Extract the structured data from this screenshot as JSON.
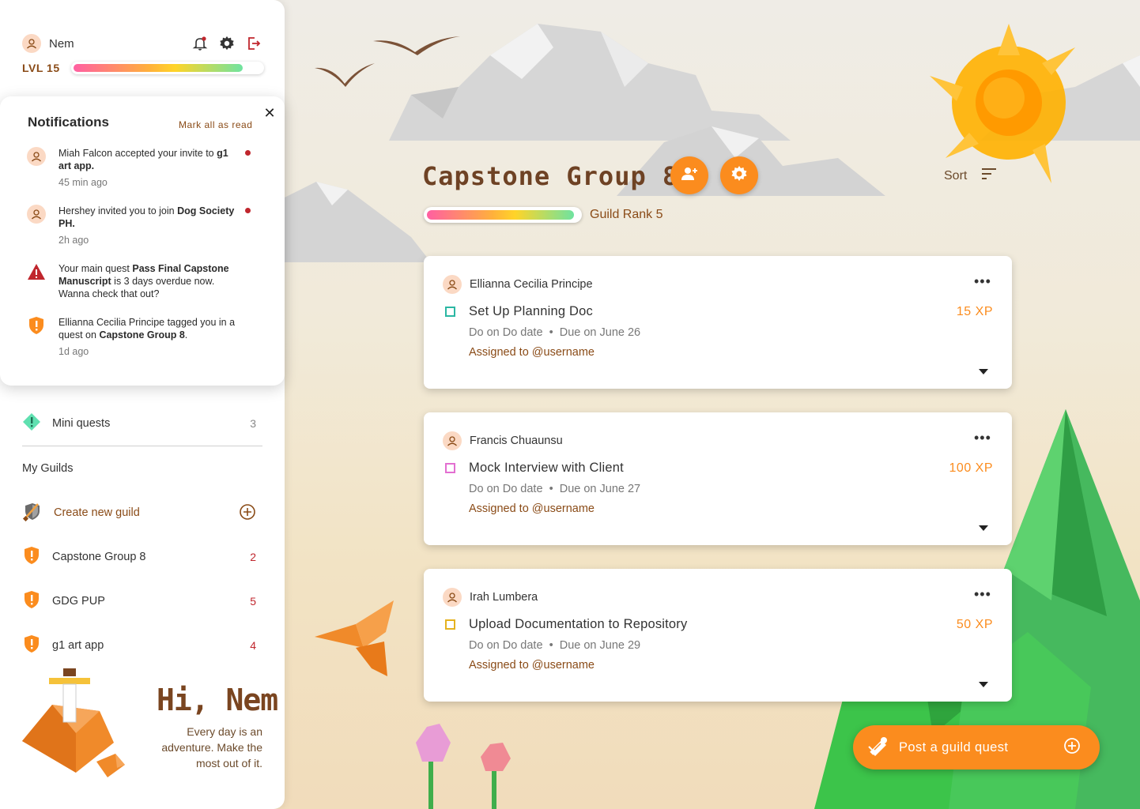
{
  "user": {
    "name": "Nem",
    "level": "LVL 15",
    "level_progress": 0.9
  },
  "notifications": {
    "title": "Notifications",
    "mark_all": "Mark all as read",
    "items": [
      {
        "pre": "Miah Falcon accepted your invite to ",
        "bold": "g1 art app.",
        "post": "",
        "time": "45 min ago",
        "unread": true,
        "icon": "avatar-icon"
      },
      {
        "pre": "Hershey invited you to join ",
        "bold": "Dog Society PH.",
        "post": "",
        "time": "2h ago",
        "unread": true,
        "icon": "avatar-icon"
      },
      {
        "pre": "Your main quest ",
        "bold": "Pass Final Capstone Manuscript",
        "post": " is 3 days overdue now. Wanna check that out?",
        "time": "",
        "unread": false,
        "icon": "warning-icon"
      },
      {
        "pre": "Ellianna Cecilia Principe tagged you in a quest on ",
        "bold": "Capstone Group 8",
        "post": ".",
        "time": "1d ago",
        "unread": false,
        "icon": "guild-shield-icon"
      }
    ]
  },
  "sidebar": {
    "mini_quests": {
      "label": "Mini quests",
      "count": "3"
    },
    "my_guilds": "My Guilds",
    "create_guild": "Create new guild",
    "guilds": [
      {
        "name": "Capstone Group 8",
        "count": "2"
      },
      {
        "name": "GDG PUP",
        "count": "5"
      },
      {
        "name": "g1 art app",
        "count": "4"
      }
    ],
    "greeting": "Hi, Nem",
    "tagline": "Every day is an adventure. Make the most out of it."
  },
  "guild": {
    "title": "Capstone Group 8",
    "rank": "Guild Rank 5",
    "rank_progress": 0.97,
    "sort_label": "Sort"
  },
  "quests": [
    {
      "user": "Ellianna Cecilia Principe",
      "title": "Set Up Planning Doc",
      "xp": "15 XP",
      "do_on": "Do on Do date",
      "due": "Due on June 26",
      "assigned": "Assigned to @username",
      "color": "#2bb7a3"
    },
    {
      "user": "Francis Chuaunsu",
      "title": "Mock Interview with Client",
      "xp": "100 XP",
      "do_on": "Do on Do date",
      "due": "Due on June 27",
      "assigned": "Assigned to @username",
      "color": "#e36fd1"
    },
    {
      "user": "Irah Lumbera",
      "title": "Upload Documentation to Repository",
      "xp": "50 XP",
      "do_on": "Do on Do date",
      "due": "Due on June 29",
      "assigned": "Assigned to @username",
      "color": "#e5b21f"
    }
  ],
  "post_button": "Post a guild quest",
  "colors": {
    "accent": "#fb8c1e",
    "brown": "#8a4b17",
    "alert": "#c0262d"
  }
}
